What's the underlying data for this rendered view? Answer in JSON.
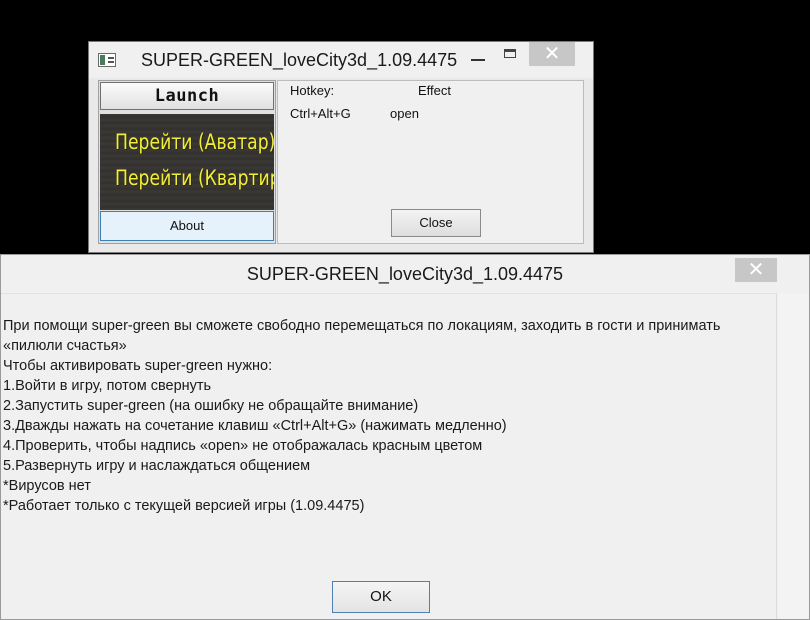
{
  "main_window": {
    "title": "SUPER-GREEN_loveCity3d_1.09.4475",
    "close_glyph": "✕",
    "launch_label": "Launch",
    "preview": {
      "line1": "Перейти (Аватар)",
      "line2": "Перейти (Квартира)"
    },
    "about_label": "About",
    "hotkey_header": "Hotkey:",
    "effect_header": "Effect",
    "hotkey_value": "Ctrl+Alt+G",
    "effect_value": "open",
    "close_label": "Close",
    "icons": [
      "app-icon",
      "minimize-icon",
      "maximize-icon",
      "close-icon"
    ]
  },
  "dialog": {
    "title": "SUPER-GREEN_loveCity3d_1.09.4475",
    "close_glyph": "✕",
    "lines": [
      "При помощи super-green вы сможете свободно перемещаться по локациям, заходить в гости и принимать",
      "«пилюли счастья»",
      "Чтобы активировать super-green нужно:",
      "1.Войти в игру, потом свернуть",
      "2.Запустить super-green (на ошибку не обращайте внимание)",
      "3.Дважды нажать на сочетание клавиш «Ctrl+Alt+G» (нажимать медленно)",
      "4.Проверить, чтобы  надпись «open» не отображалась красным цветом",
      "5.Развернуть игру и наслаждаться общением",
      "*Вирусов нет",
      "*Работает только с текущей версией игры (1.09.4475)"
    ],
    "ok_label": "OK"
  },
  "colors": {
    "desktop": "#000000",
    "preview_text": "#f3ee3b",
    "focus_border": "#3c7fb1",
    "close_button_bg": "#c7c7c7"
  }
}
